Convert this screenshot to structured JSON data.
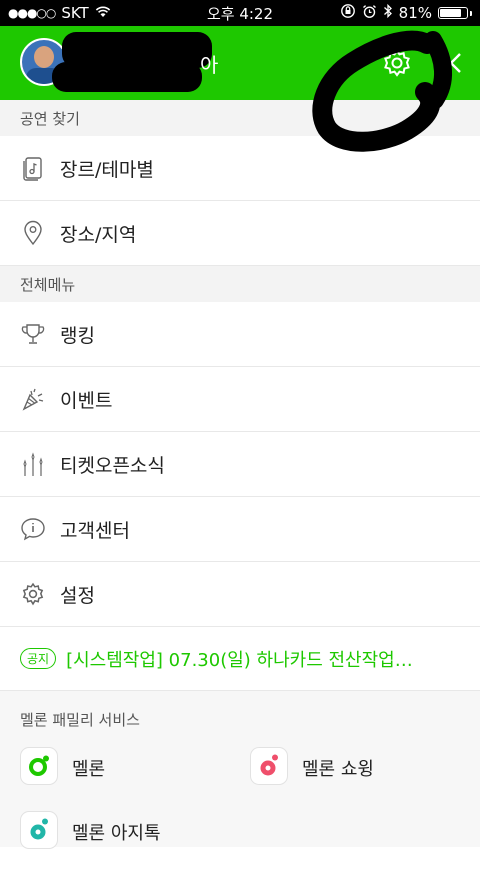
{
  "status_bar": {
    "signal_dots": "●●●○○",
    "carrier": "SKT",
    "time": "오후 4:22",
    "battery_percent": "81%",
    "battery_level": 0.81
  },
  "header": {
    "name_visible": "아",
    "background_color": "#1ec800"
  },
  "sections": {
    "find_performance": "공연 찾기",
    "all_menu": "전체메뉴"
  },
  "find_items": [
    {
      "label": "장르/테마별",
      "icon": "music-file-icon"
    },
    {
      "label": "장소/지역",
      "icon": "location-pin-icon"
    }
  ],
  "menu_items": [
    {
      "label": "랭킹",
      "icon": "trophy-icon"
    },
    {
      "label": "이벤트",
      "icon": "party-popper-icon"
    },
    {
      "label": "티켓오픈소식",
      "icon": "fireworks-icon"
    },
    {
      "label": "고객센터",
      "icon": "info-bubble-icon"
    },
    {
      "label": "설정",
      "icon": "gear-icon"
    }
  ],
  "notice": {
    "badge": "공지",
    "text": "[시스템작업] 07.30(일) 하나카드 전산작업…"
  },
  "family": {
    "title": "멜론 패밀리 서비스",
    "items": [
      {
        "label": "멜론",
        "icon": "melon-app-icon",
        "color": "#1ec800"
      },
      {
        "label": "멜론 쇼윙",
        "icon": "melon-showing-app-icon",
        "color": "#ef4f6b"
      },
      {
        "label": "멜론 아지톡",
        "icon": "melon-azitalk-app-icon",
        "color": "#21b6a8"
      }
    ]
  }
}
